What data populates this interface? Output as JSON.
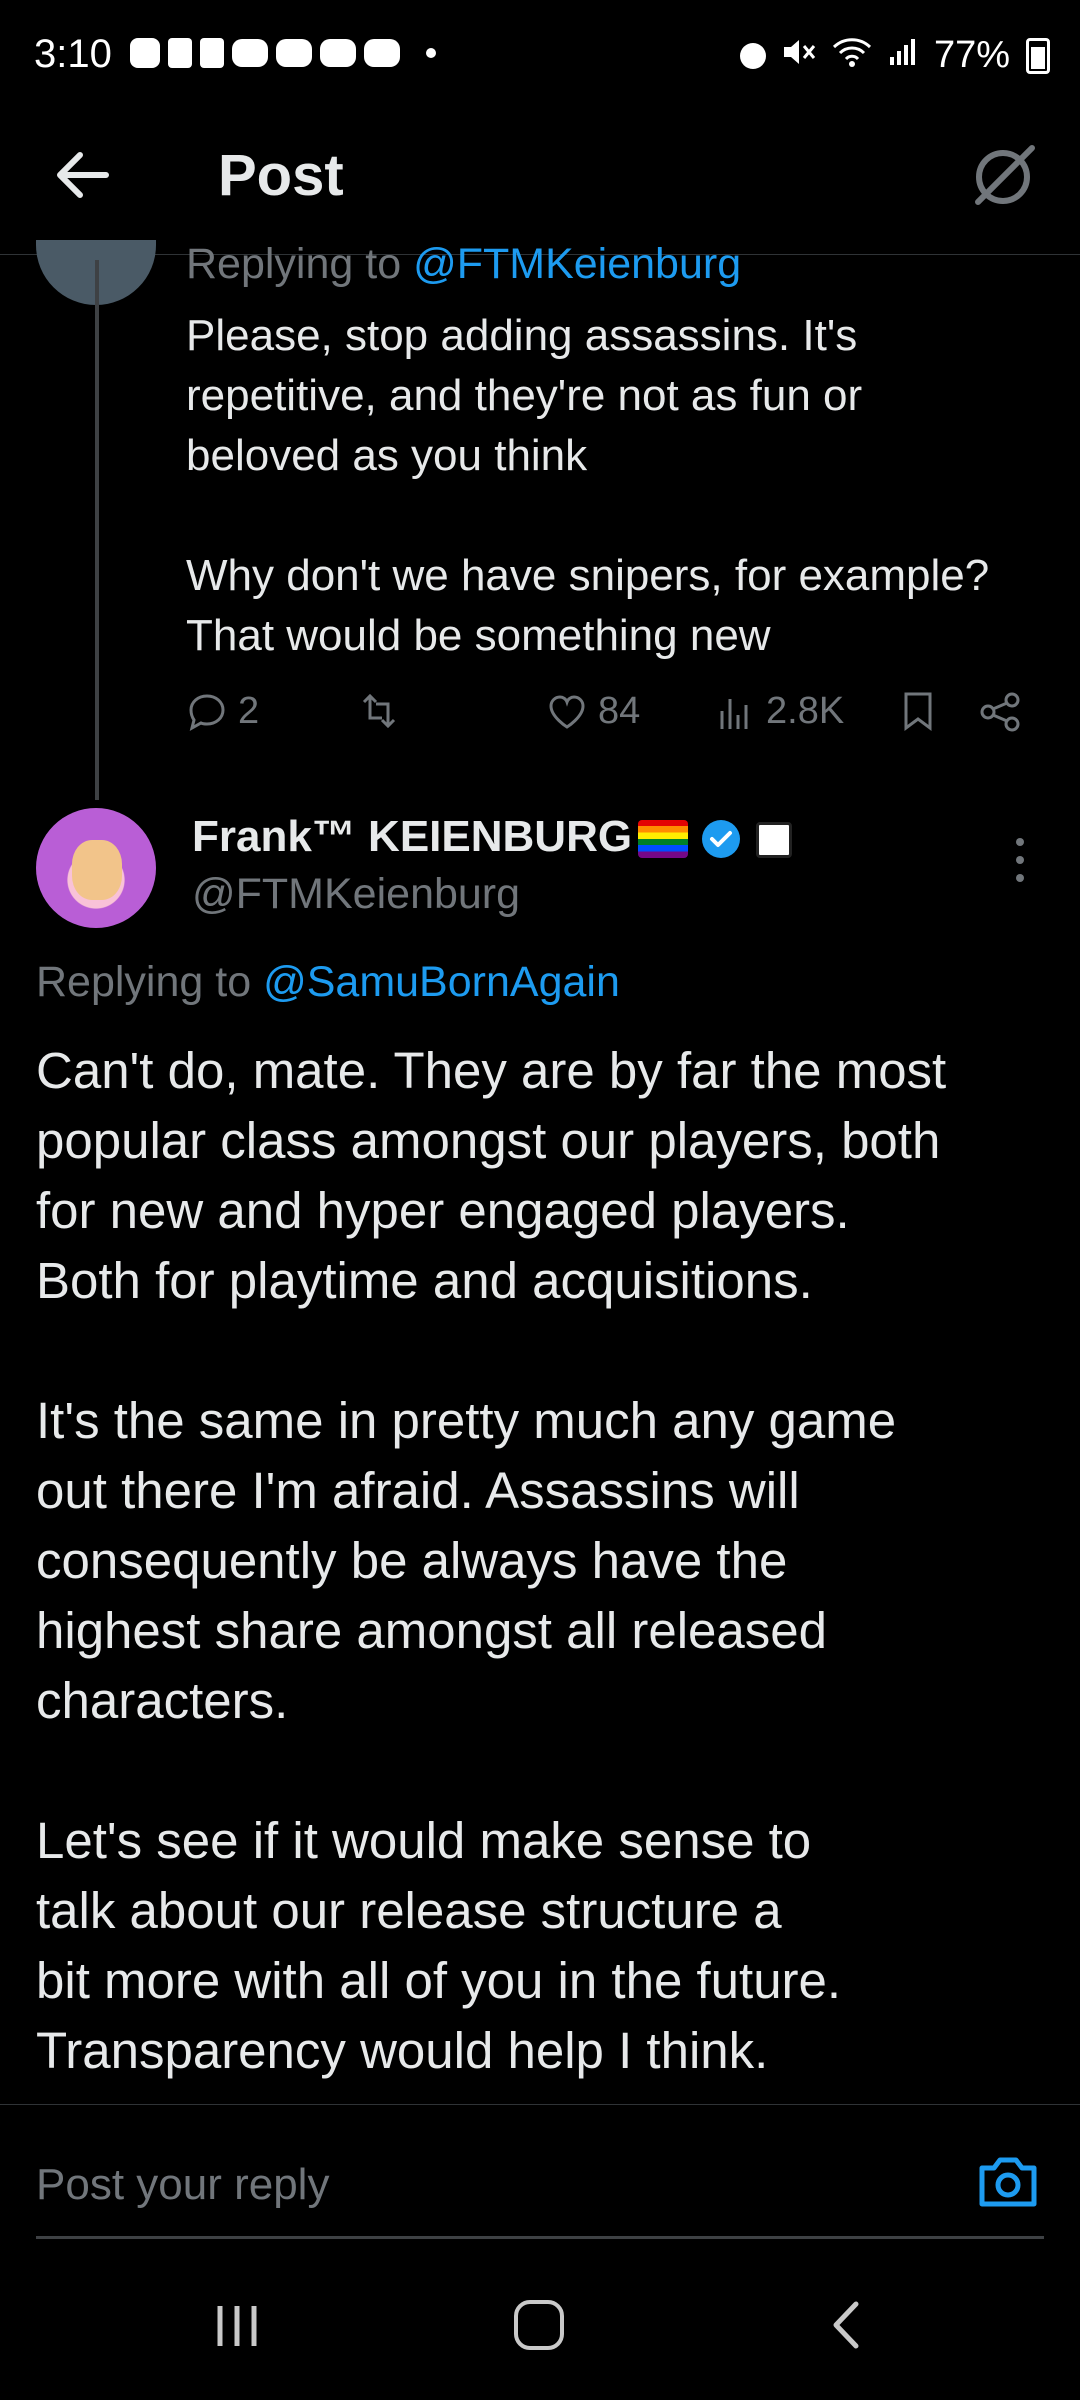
{
  "status_bar": {
    "time": "3:10",
    "battery": "77%",
    "left_icons": [
      "whatsapp-icon",
      "tiktok-icon",
      "tiktok-icon",
      "youtube-icon",
      "youtube-icon",
      "youtube-icon",
      "youtube-icon",
      "dot-icon"
    ],
    "right_icons": [
      "alarm-icon",
      "mute-icon",
      "wifi-icon",
      "signal-icon",
      "battery-icon"
    ]
  },
  "header": {
    "title": "Post"
  },
  "parent_post": {
    "replying_prefix": "Replying to ",
    "replying_handle": "@FTMKeienburg",
    "text": "Please, stop adding assassins. It's\nrepetitive, and they're not as fun or\nbeloved as you think\n\nWhy don't we have snipers, for example?\nThat would be something new",
    "replies": "2",
    "likes": "84",
    "views": "2.8K"
  },
  "main_post": {
    "display_name": "Frank™ KEIENBURG",
    "handle": "@FTMKeienburg",
    "replying_prefix": "Replying to ",
    "replying_handle": "@SamuBornAgain",
    "text": "Can't do, mate. They are by far the most\npopular class amongst our players, both\nfor new and hyper engaged players.\nBoth for playtime and acquisitions.\n\nIt's the same in pretty much any game\nout there I'm afraid. Assassins will\nconsequently be always have the\nhighest share amongst all released\ncharacters.\n\nLet's see if it would make sense to\ntalk about our release structure a\nbit more with all of you in the future.\nTransparency would help I think."
  },
  "reply_bar": {
    "placeholder": "Post your reply"
  },
  "colors": {
    "accent": "#1d9bf0",
    "muted": "#71767b",
    "text": "#e7e9ea",
    "background": "#000000"
  }
}
